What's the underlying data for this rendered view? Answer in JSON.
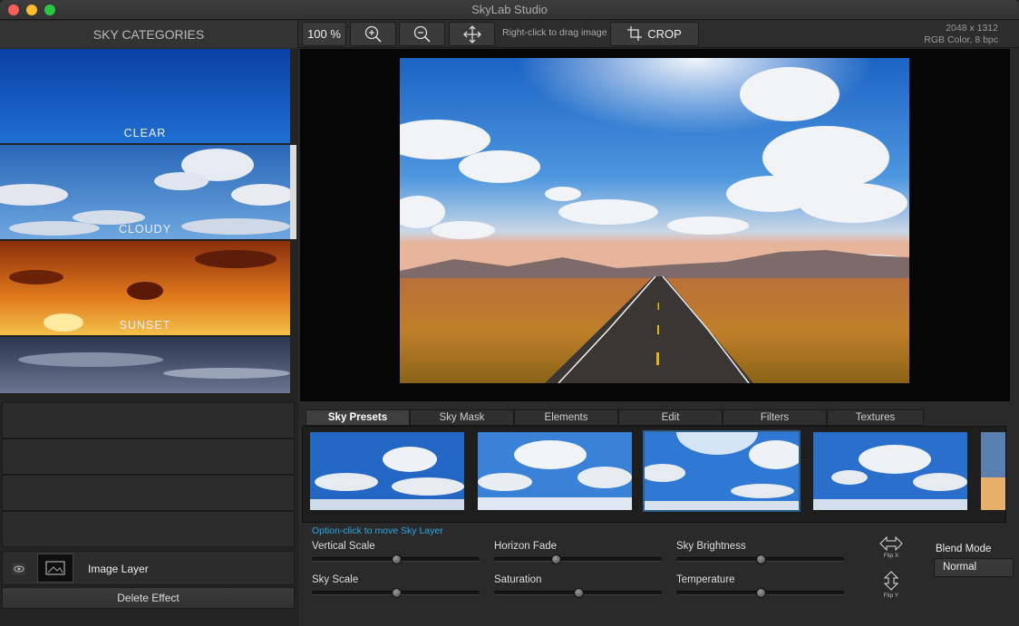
{
  "window": {
    "title": "SkyLab Studio"
  },
  "toolbar": {
    "categories_header": "SKY CATEGORIES",
    "zoom_label": "100 %",
    "hint": "Right-click to drag image",
    "crop_label": "CROP",
    "image_size": "2048 x 1312",
    "color_mode": "RGB Color, 8 bpc"
  },
  "categories": [
    {
      "label": "CLEAR"
    },
    {
      "label": "CLOUDY"
    },
    {
      "label": "SUNSET"
    },
    {
      "label": ""
    }
  ],
  "layers": {
    "layer_name": "Image Layer",
    "delete_label": "Delete Effect"
  },
  "tabs": [
    "Sky Presets",
    "Sky Mask",
    "Elements",
    "Edit",
    "Filters",
    "Textures"
  ],
  "controls": {
    "note": "Option-click to move Sky Layer",
    "sliders": [
      {
        "label": "Vertical Scale",
        "value": 0.5
      },
      {
        "label": "Horizon Fade",
        "value": 0.37
      },
      {
        "label": "Sky Brightness",
        "value": 0.5
      },
      {
        "label": "Sky Scale",
        "value": 0.5
      },
      {
        "label": "Saturation",
        "value": 0.5
      },
      {
        "label": "Temperature",
        "value": 0.5
      }
    ],
    "flip_x": "Flip X",
    "flip_y": "Flip Y",
    "blend_mode_label": "Blend Mode",
    "blend_mode_value": "Normal"
  },
  "colors": {
    "accent": "#29a8e8",
    "selection": "#2d5f8a"
  }
}
